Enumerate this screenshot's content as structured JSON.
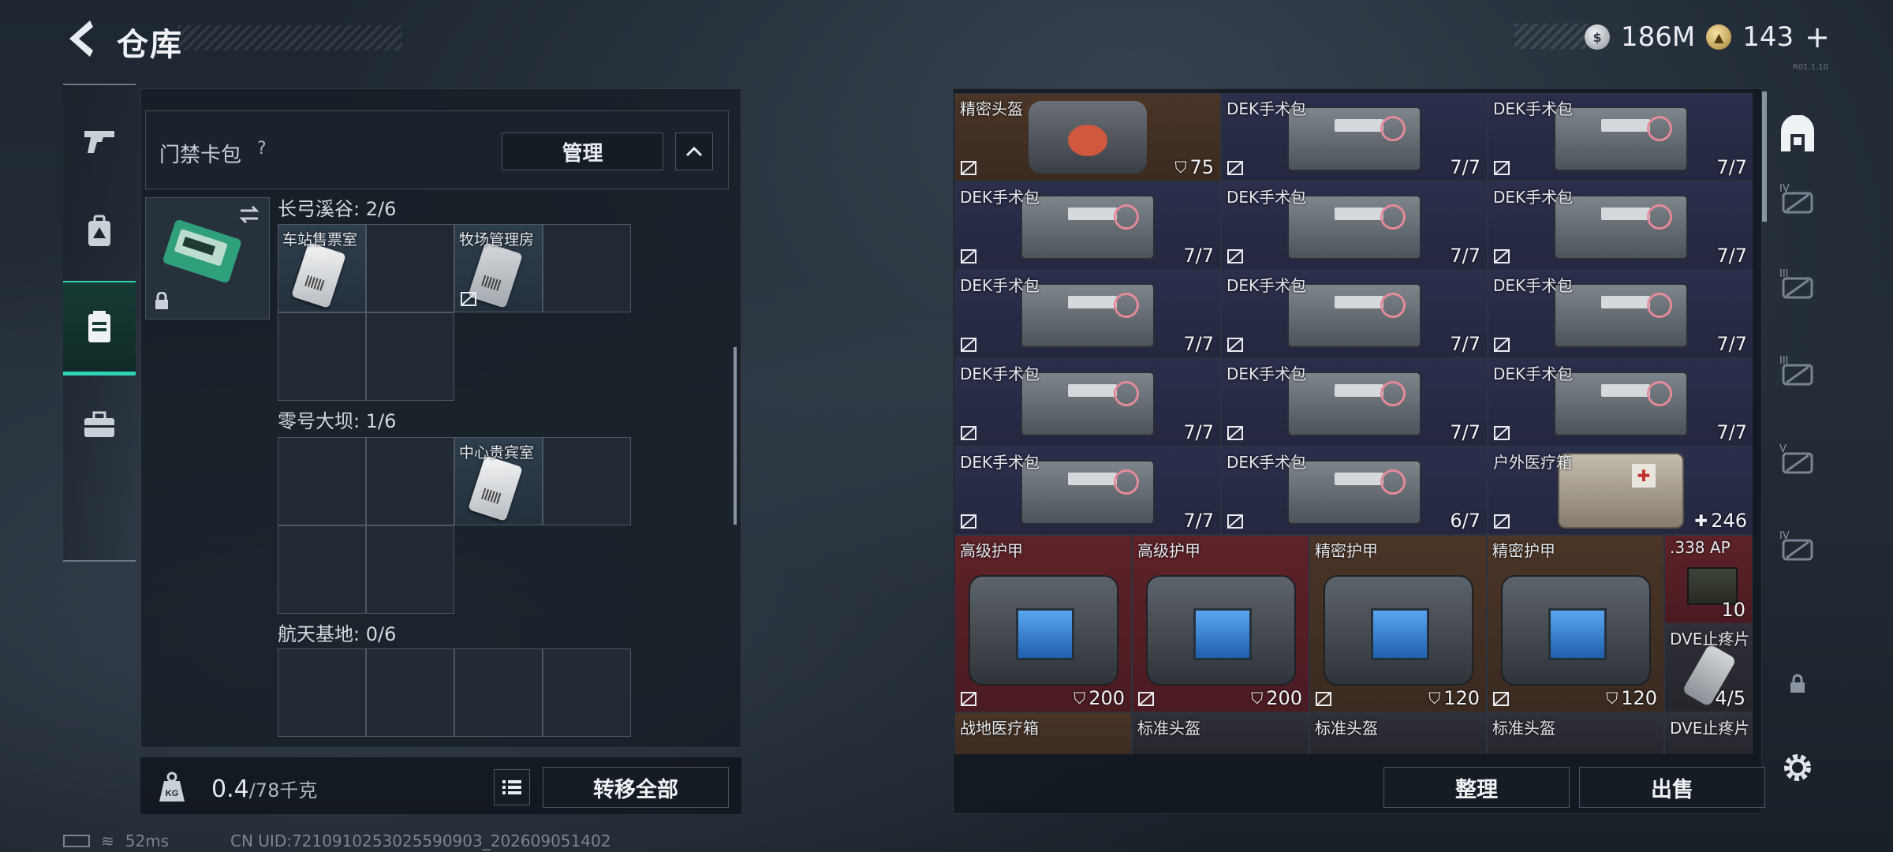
{
  "header": {
    "title": "仓库"
  },
  "currency": {
    "silver_amount": "186M",
    "gold_amount": "143"
  },
  "version": "R01.1.10",
  "left_nav": [
    "weapon-tab",
    "backpack-tab",
    "keycard-tab",
    "toolbox-tab"
  ],
  "card_panel": {
    "label": "门禁卡包",
    "help": "?",
    "manage_label": "管理",
    "areas": [
      {
        "title": "长弓溪谷: 2/6",
        "cells": [
          {
            "label": "车站售票室"
          },
          {
            "label": ""
          },
          {
            "label": "牧场管理房"
          },
          {
            "label": ""
          },
          {
            "label": ""
          },
          {
            "label": ""
          }
        ]
      },
      {
        "title": "零号大坝: 1/6",
        "cells": [
          {
            "label": ""
          },
          {
            "label": ""
          },
          {
            "label": "中心贵宾室"
          },
          {
            "label": ""
          },
          {
            "label": ""
          },
          {
            "label": ""
          }
        ]
      },
      {
        "title": "航天基地: 0/6",
        "cells": [
          {
            "label": ""
          }
        ]
      }
    ]
  },
  "weight": {
    "current": "0.4",
    "max": "/78千克"
  },
  "buttons": {
    "transfer_all": "转移全部",
    "sort": "整理",
    "sell": "出售"
  },
  "inventory": [
    {
      "name": "精密头盔",
      "value": "75",
      "color": "brown",
      "kind": "helmet",
      "prefix": "shield"
    },
    {
      "name": "DEK手术包",
      "value": "7/7",
      "color": "purple",
      "kind": "kit"
    },
    {
      "name": "DEK手术包",
      "value": "7/7",
      "color": "purple",
      "kind": "kit"
    },
    {
      "name": "DEK手术包",
      "value": "7/7",
      "color": "purple",
      "kind": "kit"
    },
    {
      "name": "DEK手术包",
      "value": "7/7",
      "color": "purple",
      "kind": "kit"
    },
    {
      "name": "DEK手术包",
      "value": "7/7",
      "color": "purple",
      "kind": "kit"
    },
    {
      "name": "DEK手术包",
      "value": "7/7",
      "color": "purple",
      "kind": "kit"
    },
    {
      "name": "DEK手术包",
      "value": "7/7",
      "color": "purple",
      "kind": "kit"
    },
    {
      "name": "DEK手术包",
      "value": "7/7",
      "color": "purple",
      "kind": "kit"
    },
    {
      "name": "DEK手术包",
      "value": "7/7",
      "color": "purple",
      "kind": "kit"
    },
    {
      "name": "DEK手术包",
      "value": "7/7",
      "color": "purple",
      "kind": "kit"
    },
    {
      "name": "DEK手术包",
      "value": "7/7",
      "color": "purple",
      "kind": "kit"
    },
    {
      "name": "DEK手术包",
      "value": "7/7",
      "color": "purple",
      "kind": "kit"
    },
    {
      "name": "DEK手术包",
      "value": "6/7",
      "color": "purple",
      "kind": "kit"
    },
    {
      "name": "户外医疗箱",
      "value": "246",
      "color": "purple",
      "kind": "medbox",
      "prefix": "plus"
    }
  ],
  "armor": [
    {
      "name": "高级护甲",
      "value": "200",
      "color": "red"
    },
    {
      "name": "高级护甲",
      "value": "200",
      "color": "red"
    },
    {
      "name": "精密护甲",
      "value": "120",
      "color": "brown"
    },
    {
      "name": "精密护甲",
      "value": "120",
      "color": "brown"
    }
  ],
  "small_items": [
    {
      "name": ".338 AP",
      "value": "10",
      "color": "red",
      "kind": "ammo"
    },
    {
      "name": "DVE止疼片",
      "value": "4/5",
      "color": "dark",
      "kind": "syringe"
    }
  ],
  "partial_row": [
    {
      "name": "战地医疗箱",
      "color": "brown"
    },
    {
      "name": "标准头盔",
      "color": "dark"
    },
    {
      "name": "标准头盔",
      "color": "dark"
    },
    {
      "name": "标准头盔",
      "color": "dark"
    },
    {
      "name": "DVE止疼片",
      "color": "dark"
    }
  ],
  "right_side": [
    {
      "name": "container-tab",
      "level": ""
    },
    {
      "name": "helmet-slot",
      "level": "IV"
    },
    {
      "name": "armor-slot",
      "level": "III"
    },
    {
      "name": "rig-slot",
      "level": "III"
    },
    {
      "name": "backpack-slot",
      "level": "V"
    },
    {
      "name": "pouch-slot",
      "level": "IV"
    },
    {
      "name": "lock",
      "level": ""
    }
  ],
  "status": {
    "ping": "52ms",
    "uid": "CN UID:7210910253025590903_202609051402"
  }
}
